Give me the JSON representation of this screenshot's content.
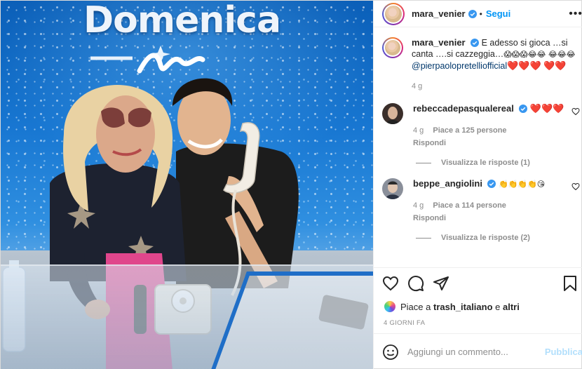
{
  "photo": {
    "show_title": "Domenica",
    "colors": {
      "backdrop": "#1877d2",
      "desk_stripe": "#1f6ec7"
    }
  },
  "post": {
    "author": "mara_venier",
    "follow_label": "Segui",
    "separator": "•",
    "more_icon": "•••",
    "caption_text": "E adesso si gioca …si canta ….si cazzeggia…",
    "caption_emojis_1": "😱😱😱😂😂",
    "caption_emojis_2": "😂😂😂",
    "caption_mention": "@pierpaolopretelliofficial",
    "caption_hearts_1": "❤️❤️❤️",
    "caption_hearts_2": "❤️❤️",
    "caption_age": "4 g"
  },
  "comments": [
    {
      "user": "rebeccadepasqualereal",
      "text": "❤️❤️❤️",
      "age": "4 g",
      "likes": "Piace a 125 persone",
      "reply_label": "Rispondi",
      "view_replies": "Visualizza le risposte (1)"
    },
    {
      "user": "beppe_angiolini",
      "text": "👏👏👏👏😘",
      "age": "4 g",
      "likes": "Piace a 114 persone",
      "reply_label": "Rispondi",
      "view_replies": "Visualizza le risposte (2)"
    }
  ],
  "likes_line": {
    "prefix": "Piace a",
    "user": "trash_italiano",
    "middle": "e",
    "suffix": "altri"
  },
  "date_label": "4 GIORNI FA",
  "comment_box": {
    "placeholder": "Aggiungi un commento...",
    "publish_label": "Pubblica"
  },
  "colors": {
    "link": "#0095f6",
    "muted": "#8e8e8e",
    "heart": "#ed4956",
    "publish_disabled": "#b2dffc"
  }
}
